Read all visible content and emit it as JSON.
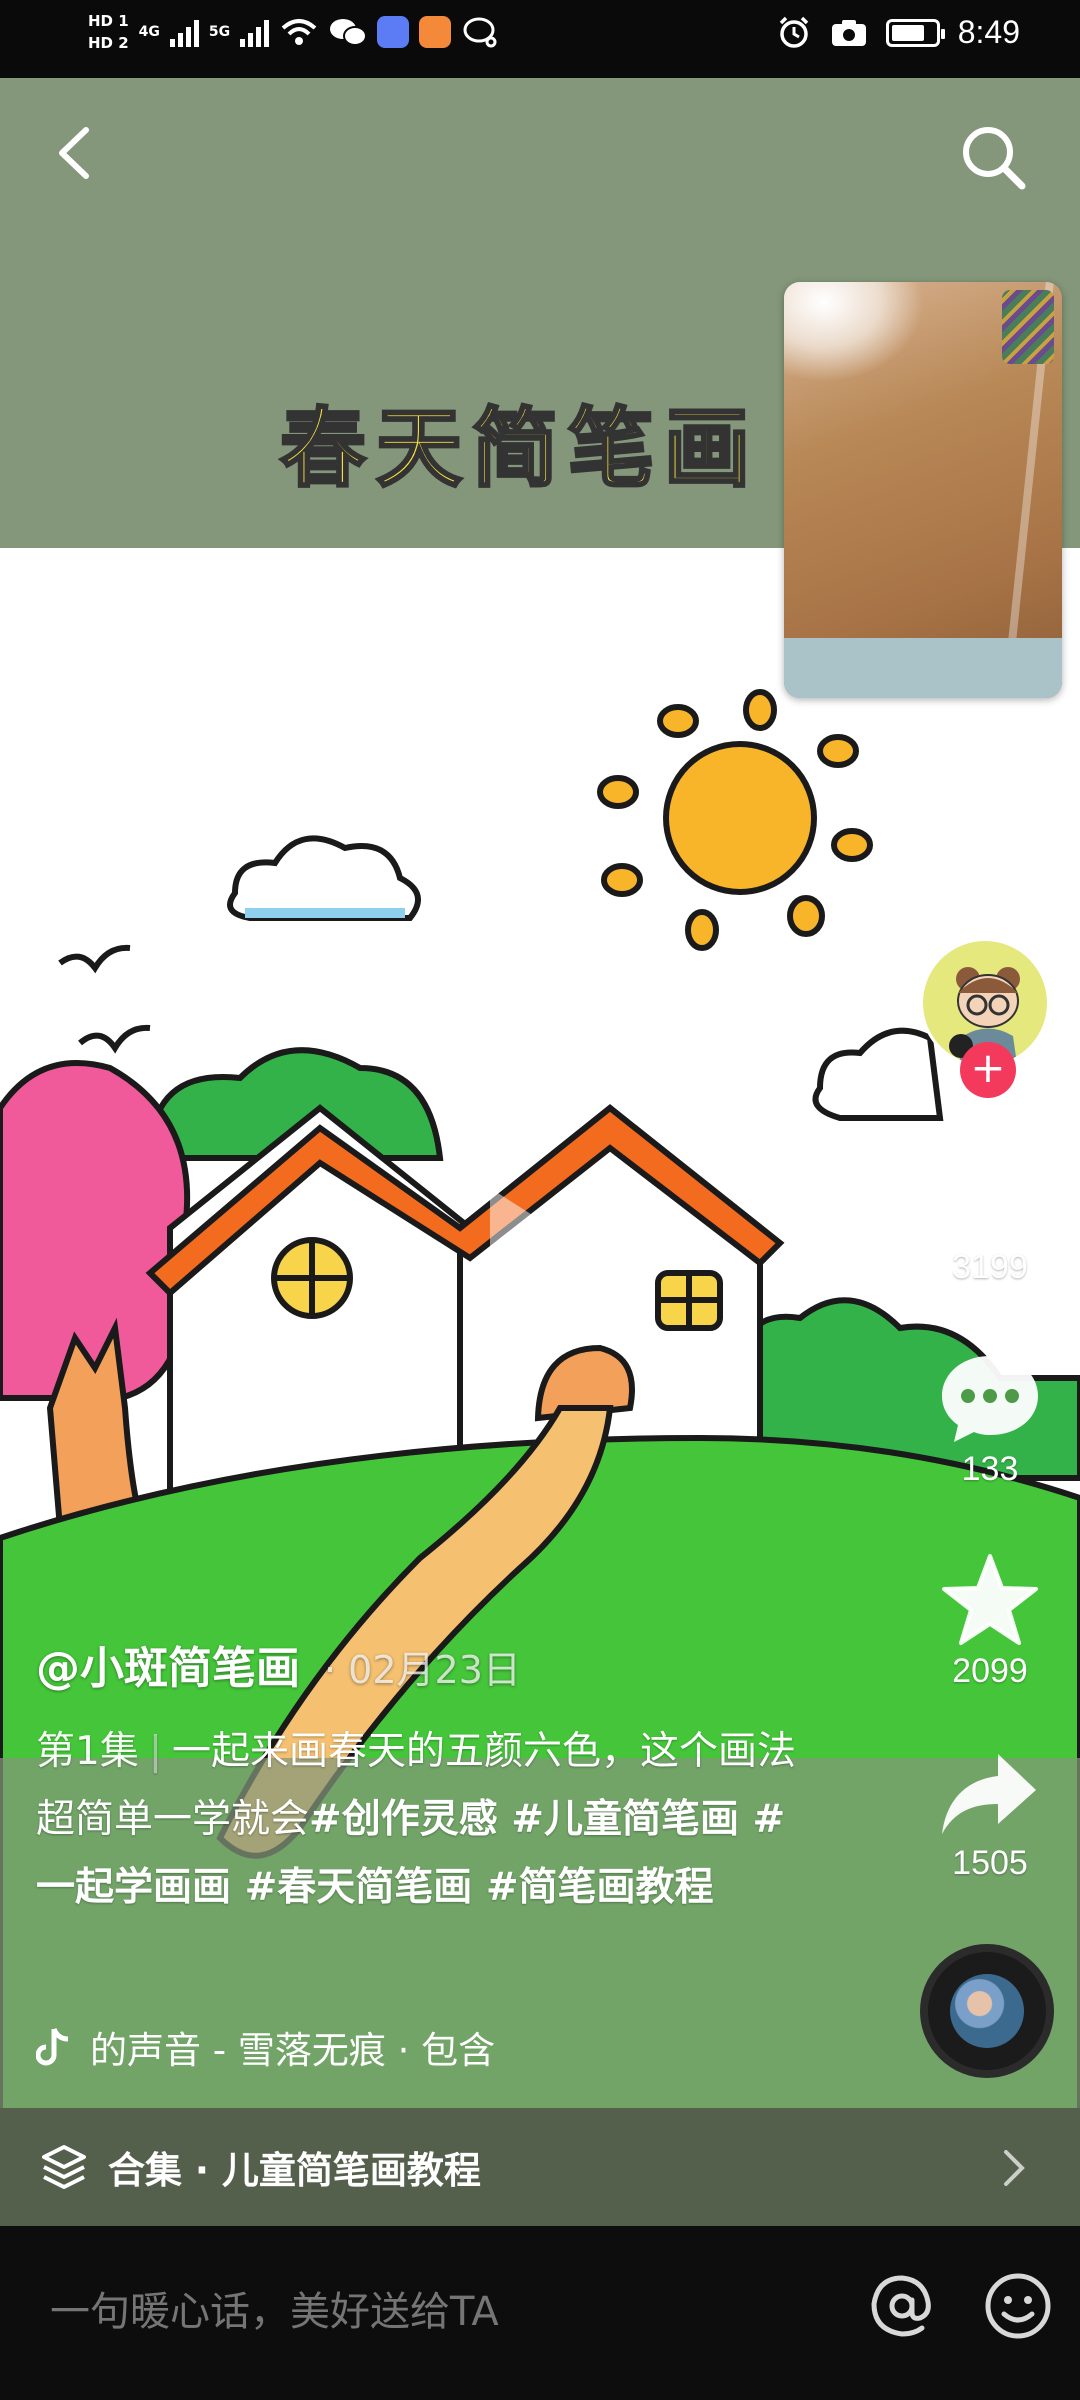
{
  "status_bar": {
    "hd1": "HD 1",
    "hd2": "HD 2",
    "net1": "4G",
    "net2": "5G",
    "time": "8:49"
  },
  "video": {
    "title_banner": "春天简笔画",
    "colors": {
      "banner_bg": "#84977a",
      "sky": "#ffffff",
      "grass": "#45c63a",
      "roof": "#f26b1e",
      "sun": "#f9b52a"
    }
  },
  "nav": {
    "back_icon": "chevron-left-icon",
    "search_icon": "search-icon"
  },
  "actions": {
    "like_count": "3199",
    "comment_count": "133",
    "favorite_count": "2099",
    "share_count": "1505"
  },
  "post": {
    "username": "@小斑简笔画",
    "date": "· 02月23日",
    "episode": "第1集",
    "caption_text": "一起来画春天的五颜六色，这个画法超简单一学就会",
    "hashtags": "#创作灵感 #儿童简笔画 #一起学画画 #春天简笔画 #简笔画教程",
    "music": "的声音 - 雪落无痕 · 包含"
  },
  "collection": {
    "label": "合集 · 儿童简笔画教程"
  },
  "comment_bar": {
    "placeholder": "一句暖心话，美好送给TA"
  }
}
